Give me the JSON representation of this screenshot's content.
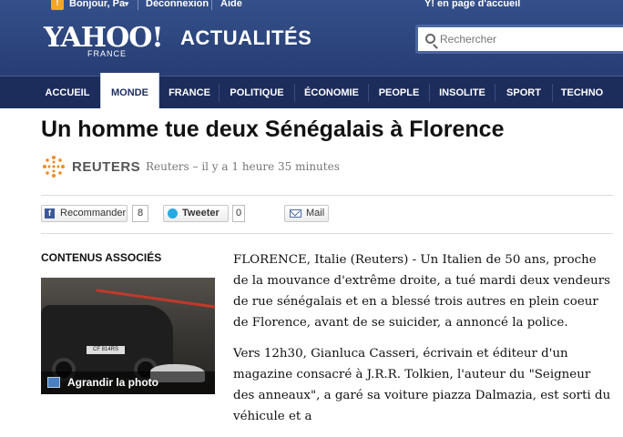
{
  "util": {
    "greeting": "Bonjour, Pa",
    "logout": "Déconnexion",
    "help": "Aide",
    "homepage": "Y! en page d'accueil"
  },
  "brand": {
    "logo": "YAHOO!",
    "logo_sub": "FRANCE",
    "section": "ACTUALITÉS"
  },
  "search": {
    "placeholder": "Rechercher"
  },
  "nav": {
    "items": [
      "ACCUEIL",
      "MONDE",
      "FRANCE",
      "POLITIQUE",
      "ÉCONOMIE",
      "PEOPLE",
      "INSOLITE",
      "SPORT",
      "TECHNO"
    ],
    "active": "MONDE"
  },
  "article": {
    "headline": "Un homme tue deux Sénégalais à Florence",
    "source": "REUTERS",
    "byline": "Reuters – il y a 1 heure 35 minutes",
    "paragraphs": [
      "FLORENCE, Italie (Reuters) - Un Italien de 50 ans, proche de la mouvance d'extrême droite, a tué mardi deux vendeurs de rue sénégalais et en a blessé trois autres en plein coeur de Florence, avant de se suicider, a annoncé la police.",
      "Vers 12h30, Gianluca Casseri, écrivain et éditeur d'un magazine consacré à J.R.R. Tolkien, l'auteur du \"Seigneur des anneaux\", a garé sa voiture piazza Dalmazia, est sorti du véhicule et a"
    ]
  },
  "share": {
    "recommend_label": "Recommander",
    "recommend_count": "8",
    "tweet_label": "Tweeter",
    "tweet_count": "0",
    "mail_label": "Mail"
  },
  "related": {
    "title": "CONTENUS ASSOCIÉS",
    "photo_caption": "Agrandir la photo",
    "plate": "CF 814RS"
  },
  "colors": {
    "header": "#22356a",
    "nav": "#1c2d5c",
    "accent": "#f5a623"
  }
}
